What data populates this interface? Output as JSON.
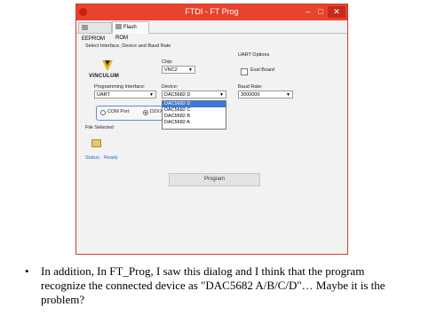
{
  "window": {
    "title": "FTDI - FT Prog",
    "min": "–",
    "max": "□",
    "close": "✕"
  },
  "tabs": [
    {
      "label": "EEPROM"
    },
    {
      "label": "Flash ROM"
    }
  ],
  "form": {
    "section_heading": "Select Interface, Device and Baud Rate",
    "chip_label": "Chip:",
    "chip_value": "VNC2",
    "uart_options_label": "UART Options",
    "eval_board_label": "Eval Board",
    "logo_text": "VINCULUM",
    "prog_interface_label": "Programming Interface:",
    "prog_interface_value": "UART",
    "device_label": "Device:",
    "device_value": "DAC5682 D",
    "device_options": [
      "DAC5682 D",
      "DAC5682 C",
      "DAC5682 B",
      "DAC5682 A"
    ],
    "baud_label": "Baud Rate:",
    "baud_value": "3000000",
    "com_port_label": "COM Port",
    "d2xx_label": "D2XX",
    "file_selected_label": "File Selected",
    "status_label": "Status:",
    "status_value": "Ready",
    "program_button": "Program"
  },
  "caption": {
    "bullet": "•",
    "text": "In addition, In FT_Prog, I saw this dialog and I think that the program recognize the connected device as \"DAC5682 A/B/C/D\"… Maybe it is the problem?"
  },
  "colors": {
    "titlebar": "#e8432d",
    "highlight": "#3b78d7",
    "status_text": "#2a6ac0"
  }
}
